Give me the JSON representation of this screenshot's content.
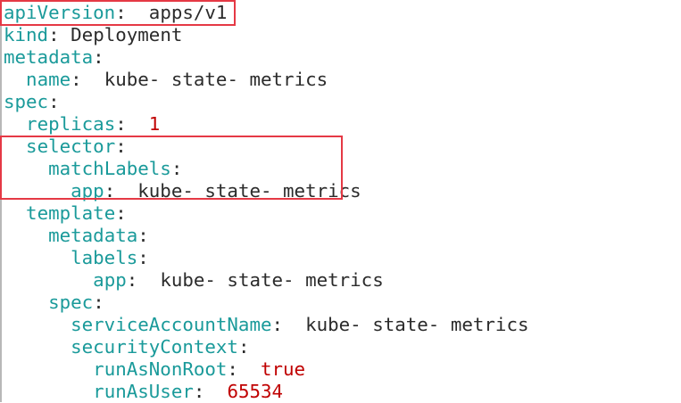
{
  "lines": [
    {
      "key": "apiVersion",
      "colon": ":",
      "value": "apps/v1",
      "value_type": "str"
    },
    {
      "key": "kind",
      "colon": ":",
      "value": "Deployment",
      "value_type": "str"
    },
    {
      "key": "metadata",
      "colon": ":",
      "value": "",
      "value_type": "str"
    },
    {
      "key": "name",
      "colon": ":",
      "value": "kube- state- metrics",
      "value_type": "str"
    },
    {
      "key": "spec",
      "colon": ":",
      "value": "",
      "value_type": "str"
    },
    {
      "key": "replicas",
      "colon": ":",
      "value": "1",
      "value_type": "num"
    },
    {
      "key": "selector",
      "colon": ":",
      "value": "",
      "value_type": "str"
    },
    {
      "key": "matchLabels",
      "colon": ":",
      "value": "",
      "value_type": "str"
    },
    {
      "key": "app",
      "colon": ":",
      "value": "kube- state- metrics",
      "value_type": "str"
    },
    {
      "key": "template",
      "colon": ":",
      "value": "",
      "value_type": "str"
    },
    {
      "key": "metadata",
      "colon": ":",
      "value": "",
      "value_type": "str"
    },
    {
      "key": "labels",
      "colon": ":",
      "value": "",
      "value_type": "str"
    },
    {
      "key": "app",
      "colon": ":",
      "value": "kube- state- metrics",
      "value_type": "str"
    },
    {
      "key": "spec",
      "colon": ":",
      "value": "",
      "value_type": "str"
    },
    {
      "key": "serviceAccountName",
      "colon": ":",
      "value": "kube- state- metrics",
      "value_type": "str"
    },
    {
      "key": "securityContext",
      "colon": ":",
      "value": "",
      "value_type": "str"
    },
    {
      "key": "runAsNonRoot",
      "colon": ":",
      "value": "true",
      "value_type": "bool"
    },
    {
      "key": "runAsUser",
      "colon": ":",
      "value": "65534",
      "value_type": "num"
    }
  ],
  "colors": {
    "key": "#1a9a9a",
    "string": "#2b2b2b",
    "number": "#c00000",
    "highlight_box": "#e53945"
  }
}
